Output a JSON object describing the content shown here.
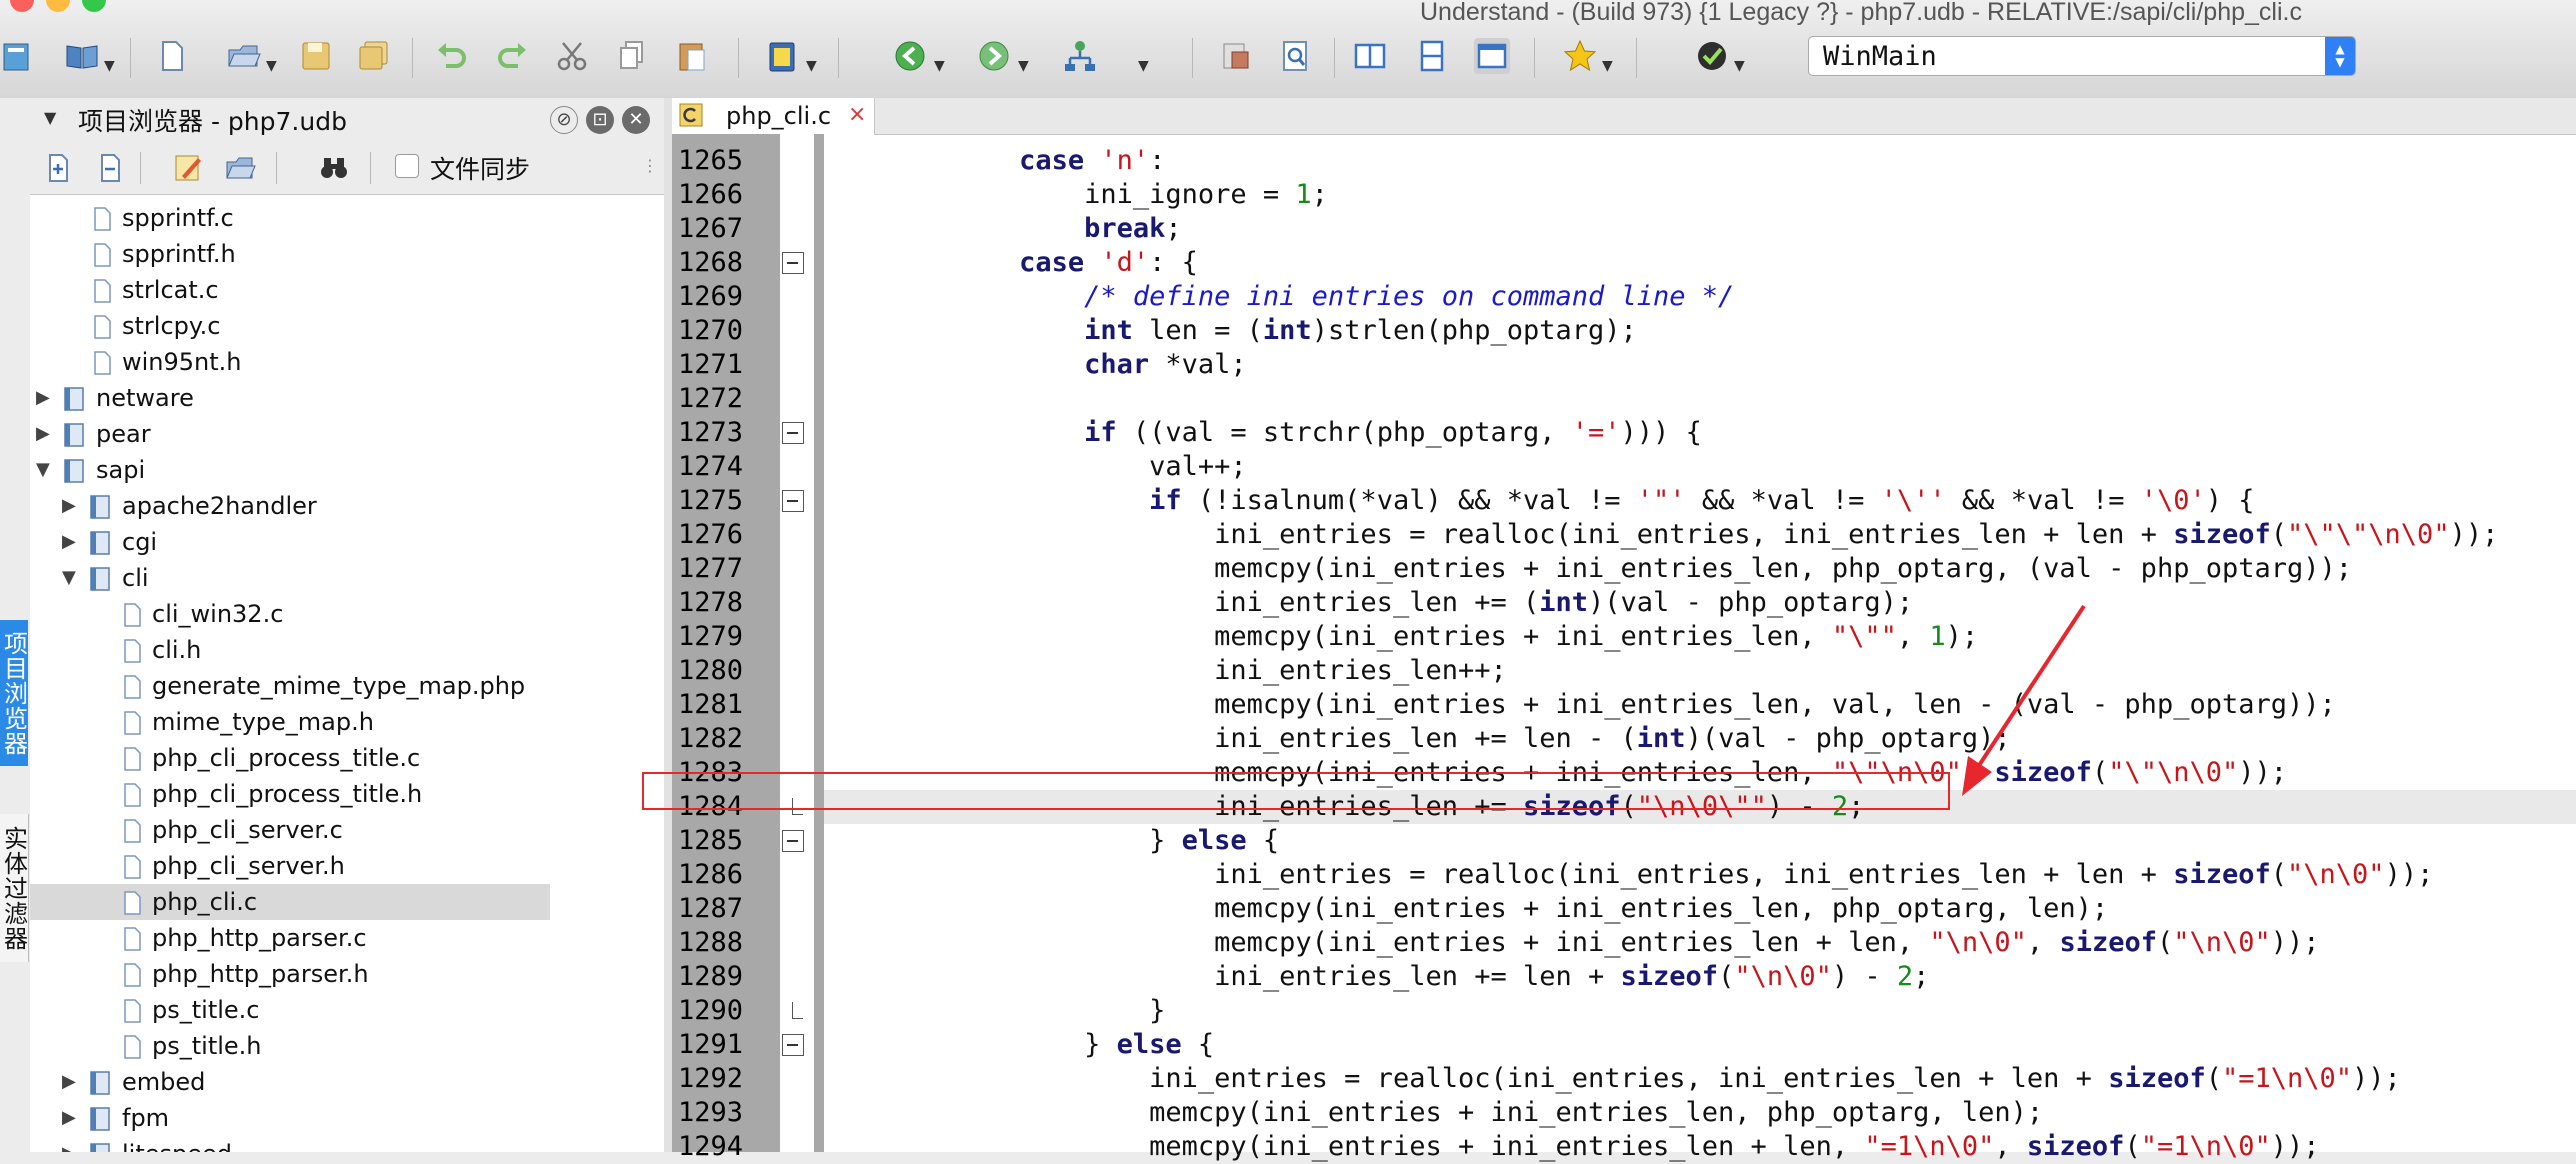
{
  "window": {
    "title": "Understand - (Build 973) {1 Legacy ?} - php7.udb - RELATIVE:/sapi/cli/php_cli.c"
  },
  "toolbar": {
    "function_select_value": "WinMain"
  },
  "side_tabs": {
    "project_browser": "项目浏览器",
    "entity_filter": "实体过滤器"
  },
  "browser": {
    "title": "项目浏览器 - php7.udb",
    "sync_label": "文件同步",
    "tree": [
      {
        "label": "spprintf.c",
        "type": "file",
        "depth": 2
      },
      {
        "label": "spprintf.h",
        "type": "file",
        "depth": 2
      },
      {
        "label": "strlcat.c",
        "type": "file",
        "depth": 2
      },
      {
        "label": "strlcpy.c",
        "type": "file",
        "depth": 2
      },
      {
        "label": "win95nt.h",
        "type": "file",
        "depth": 2
      },
      {
        "label": "netware",
        "type": "folder",
        "depth": 1,
        "expanded": false
      },
      {
        "label": "pear",
        "type": "folder",
        "depth": 1,
        "expanded": false
      },
      {
        "label": "sapi",
        "type": "folder",
        "depth": 1,
        "expanded": true
      },
      {
        "label": "apache2handler",
        "type": "folder",
        "depth": 2,
        "expanded": false
      },
      {
        "label": "cgi",
        "type": "folder",
        "depth": 2,
        "expanded": false
      },
      {
        "label": "cli",
        "type": "folder",
        "depth": 2,
        "expanded": true
      },
      {
        "label": "cli_win32.c",
        "type": "file",
        "depth": 3
      },
      {
        "label": "cli.h",
        "type": "file",
        "depth": 3
      },
      {
        "label": "generate_mime_type_map.php",
        "type": "file",
        "depth": 3
      },
      {
        "label": "mime_type_map.h",
        "type": "file",
        "depth": 3
      },
      {
        "label": "php_cli_process_title.c",
        "type": "file",
        "depth": 3
      },
      {
        "label": "php_cli_process_title.h",
        "type": "file",
        "depth": 3
      },
      {
        "label": "php_cli_server.c",
        "type": "file",
        "depth": 3
      },
      {
        "label": "php_cli_server.h",
        "type": "file",
        "depth": 3
      },
      {
        "label": "php_cli.c",
        "type": "file",
        "depth": 3,
        "selected": true
      },
      {
        "label": "php_http_parser.c",
        "type": "file",
        "depth": 3
      },
      {
        "label": "php_http_parser.h",
        "type": "file",
        "depth": 3
      },
      {
        "label": "ps_title.c",
        "type": "file",
        "depth": 3
      },
      {
        "label": "ps_title.h",
        "type": "file",
        "depth": 3
      },
      {
        "label": "embed",
        "type": "folder",
        "depth": 2,
        "expanded": false
      },
      {
        "label": "fpm",
        "type": "folder",
        "depth": 2,
        "expanded": false
      },
      {
        "label": "litespeed",
        "type": "folder",
        "depth": 2,
        "expanded": false
      }
    ]
  },
  "editor": {
    "tab_name": "php_cli.c",
    "tab_close": "×",
    "current_line": 1284,
    "lines": [
      {
        "n": "1265",
        "fold": "",
        "segs": [
          [
            "pl",
            "            "
          ],
          [
            "kw",
            "case"
          ],
          [
            "pl",
            " "
          ],
          [
            "str",
            "'n'"
          ],
          [
            "pl",
            ":"
          ]
        ]
      },
      {
        "n": "1266",
        "fold": "",
        "segs": [
          [
            "pl",
            "                ini_ignore = "
          ],
          [
            "num",
            "1"
          ],
          [
            "pl",
            ";"
          ]
        ]
      },
      {
        "n": "1267",
        "fold": "",
        "segs": [
          [
            "pl",
            "                "
          ],
          [
            "kw",
            "break"
          ],
          [
            "pl",
            ";"
          ]
        ]
      },
      {
        "n": "1268",
        "fold": "open",
        "segs": [
          [
            "pl",
            "            "
          ],
          [
            "kw",
            "case"
          ],
          [
            "pl",
            " "
          ],
          [
            "str",
            "'d'"
          ],
          [
            "pl",
            ": {"
          ]
        ]
      },
      {
        "n": "1269",
        "fold": "",
        "segs": [
          [
            "pl",
            "                "
          ],
          [
            "cm",
            "/* define ini entries on command line */"
          ]
        ]
      },
      {
        "n": "1270",
        "fold": "",
        "segs": [
          [
            "pl",
            "                "
          ],
          [
            "kw",
            "int"
          ],
          [
            "pl",
            " len = ("
          ],
          [
            "kw",
            "int"
          ],
          [
            "pl",
            ")strlen(php_optarg);"
          ]
        ]
      },
      {
        "n": "1271",
        "fold": "",
        "segs": [
          [
            "pl",
            "                "
          ],
          [
            "kw",
            "char"
          ],
          [
            "pl",
            " *val;"
          ]
        ]
      },
      {
        "n": "1272",
        "fold": "",
        "segs": [
          [
            "pl",
            ""
          ]
        ]
      },
      {
        "n": "1273",
        "fold": "open",
        "segs": [
          [
            "pl",
            "                "
          ],
          [
            "kw",
            "if"
          ],
          [
            "pl",
            " ((val = strchr(php_optarg, "
          ],
          [
            "str",
            "'='"
          ],
          [
            "pl",
            "))) {"
          ]
        ]
      },
      {
        "n": "1274",
        "fold": "",
        "segs": [
          [
            "pl",
            "                    val++;"
          ]
        ]
      },
      {
        "n": "1275",
        "fold": "open",
        "segs": [
          [
            "pl",
            "                    "
          ],
          [
            "kw",
            "if"
          ],
          [
            "pl",
            " (!isalnum(*val) && *val != "
          ],
          [
            "str",
            "'\"'"
          ],
          [
            "pl",
            " && *val != "
          ],
          [
            "str",
            "'\\''"
          ],
          [
            "pl",
            " && *val != "
          ],
          [
            "str",
            "'\\0'"
          ],
          [
            "pl",
            ") {"
          ]
        ]
      },
      {
        "n": "1276",
        "fold": "",
        "segs": [
          [
            "pl",
            "                        ini_entries = realloc(ini_entries, ini_entries_len + len + "
          ],
          [
            "kw",
            "sizeof"
          ],
          [
            "pl",
            "("
          ],
          [
            "str",
            "\"\\\"\\\"\\n\\0\""
          ],
          [
            "pl",
            "));"
          ]
        ]
      },
      {
        "n": "1277",
        "fold": "",
        "segs": [
          [
            "pl",
            "                        memcpy(ini_entries + ini_entries_len, php_optarg, (val - php_optarg));"
          ]
        ]
      },
      {
        "n": "1278",
        "fold": "",
        "segs": [
          [
            "pl",
            "                        ini_entries_len += ("
          ],
          [
            "kw",
            "int"
          ],
          [
            "pl",
            ")(val - php_optarg);"
          ]
        ]
      },
      {
        "n": "1279",
        "fold": "",
        "segs": [
          [
            "pl",
            "                        memcpy(ini_entries + ini_entries_len, "
          ],
          [
            "str",
            "\"\\\"\""
          ],
          [
            "pl",
            ", "
          ],
          [
            "num",
            "1"
          ],
          [
            "pl",
            ");"
          ]
        ]
      },
      {
        "n": "1280",
        "fold": "",
        "segs": [
          [
            "pl",
            "                        ini_entries_len++;"
          ]
        ]
      },
      {
        "n": "1281",
        "fold": "",
        "segs": [
          [
            "pl",
            "                        memcpy(ini_entries + ini_entries_len, val, len - (val - php_optarg));"
          ]
        ]
      },
      {
        "n": "1282",
        "fold": "",
        "segs": [
          [
            "pl",
            "                        ini_entries_len += len - ("
          ],
          [
            "kw",
            "int"
          ],
          [
            "pl",
            ")(val - php_optarg);"
          ]
        ]
      },
      {
        "n": "1283",
        "fold": "",
        "segs": [
          [
            "pl",
            "                        memcpy(ini_entries + ini_entries_len, "
          ],
          [
            "str",
            "\"\\\"\\n\\0\""
          ],
          [
            "pl",
            ", "
          ],
          [
            "kw",
            "sizeof"
          ],
          [
            "pl",
            "("
          ],
          [
            "str",
            "\"\\\"\\n\\0\""
          ],
          [
            "pl",
            "));"
          ]
        ]
      },
      {
        "n": "1284",
        "fold": "end",
        "segs": [
          [
            "pl",
            "                        ini_entries_len += "
          ],
          [
            "kw",
            "sizeof"
          ],
          [
            "pl",
            "("
          ],
          [
            "str",
            "\"\\n\\0\\\"\""
          ],
          [
            "pl",
            ") - "
          ],
          [
            "num",
            "2"
          ],
          [
            "pl",
            ";"
          ]
        ]
      },
      {
        "n": "1285",
        "fold": "open",
        "segs": [
          [
            "pl",
            "                    } "
          ],
          [
            "kw",
            "else"
          ],
          [
            "pl",
            " {"
          ]
        ]
      },
      {
        "n": "1286",
        "fold": "",
        "segs": [
          [
            "pl",
            "                        ini_entries = realloc(ini_entries, ini_entries_len + len + "
          ],
          [
            "kw",
            "sizeof"
          ],
          [
            "pl",
            "("
          ],
          [
            "str",
            "\"\\n\\0\""
          ],
          [
            "pl",
            "));"
          ]
        ]
      },
      {
        "n": "1287",
        "fold": "",
        "segs": [
          [
            "pl",
            "                        memcpy(ini_entries + ini_entries_len, php_optarg, len);"
          ]
        ]
      },
      {
        "n": "1288",
        "fold": "",
        "segs": [
          [
            "pl",
            "                        memcpy(ini_entries + ini_entries_len + len, "
          ],
          [
            "str",
            "\"\\n\\0\""
          ],
          [
            "pl",
            ", "
          ],
          [
            "kw",
            "sizeof"
          ],
          [
            "pl",
            "("
          ],
          [
            "str",
            "\"\\n\\0\""
          ],
          [
            "pl",
            "));"
          ]
        ]
      },
      {
        "n": "1289",
        "fold": "",
        "segs": [
          [
            "pl",
            "                        ini_entries_len += len + "
          ],
          [
            "kw",
            "sizeof"
          ],
          [
            "pl",
            "("
          ],
          [
            "str",
            "\"\\n\\0\""
          ],
          [
            "pl",
            ") - "
          ],
          [
            "num",
            "2"
          ],
          [
            "pl",
            ";"
          ]
        ]
      },
      {
        "n": "1290",
        "fold": "end",
        "segs": [
          [
            "pl",
            "                    }"
          ]
        ]
      },
      {
        "n": "1291",
        "fold": "open",
        "segs": [
          [
            "pl",
            "                } "
          ],
          [
            "kw",
            "else"
          ],
          [
            "pl",
            " {"
          ]
        ]
      },
      {
        "n": "1292",
        "fold": "",
        "segs": [
          [
            "pl",
            "                    ini_entries = realloc(ini_entries, ini_entries_len + len + "
          ],
          [
            "kw",
            "sizeof"
          ],
          [
            "pl",
            "("
          ],
          [
            "str",
            "\"=1\\n\\0\""
          ],
          [
            "pl",
            "));"
          ]
        ]
      },
      {
        "n": "1293",
        "fold": "",
        "segs": [
          [
            "pl",
            "                    memcpy(ini_entries + ini_entries_len, php_optarg, len);"
          ]
        ]
      },
      {
        "n": "1294",
        "fold": "",
        "segs": [
          [
            "pl",
            "                    memcpy(ini_entries + ini_entries_len + len, "
          ],
          [
            "str",
            "\"=1\\n\\0\""
          ],
          [
            "pl",
            ", "
          ],
          [
            "kw",
            "sizeof"
          ],
          [
            "pl",
            "("
          ],
          [
            "str",
            "\"=1\\n\\0\""
          ],
          [
            "pl",
            "));"
          ]
        ]
      }
    ]
  },
  "annotation": {
    "color": "#e8262e"
  }
}
